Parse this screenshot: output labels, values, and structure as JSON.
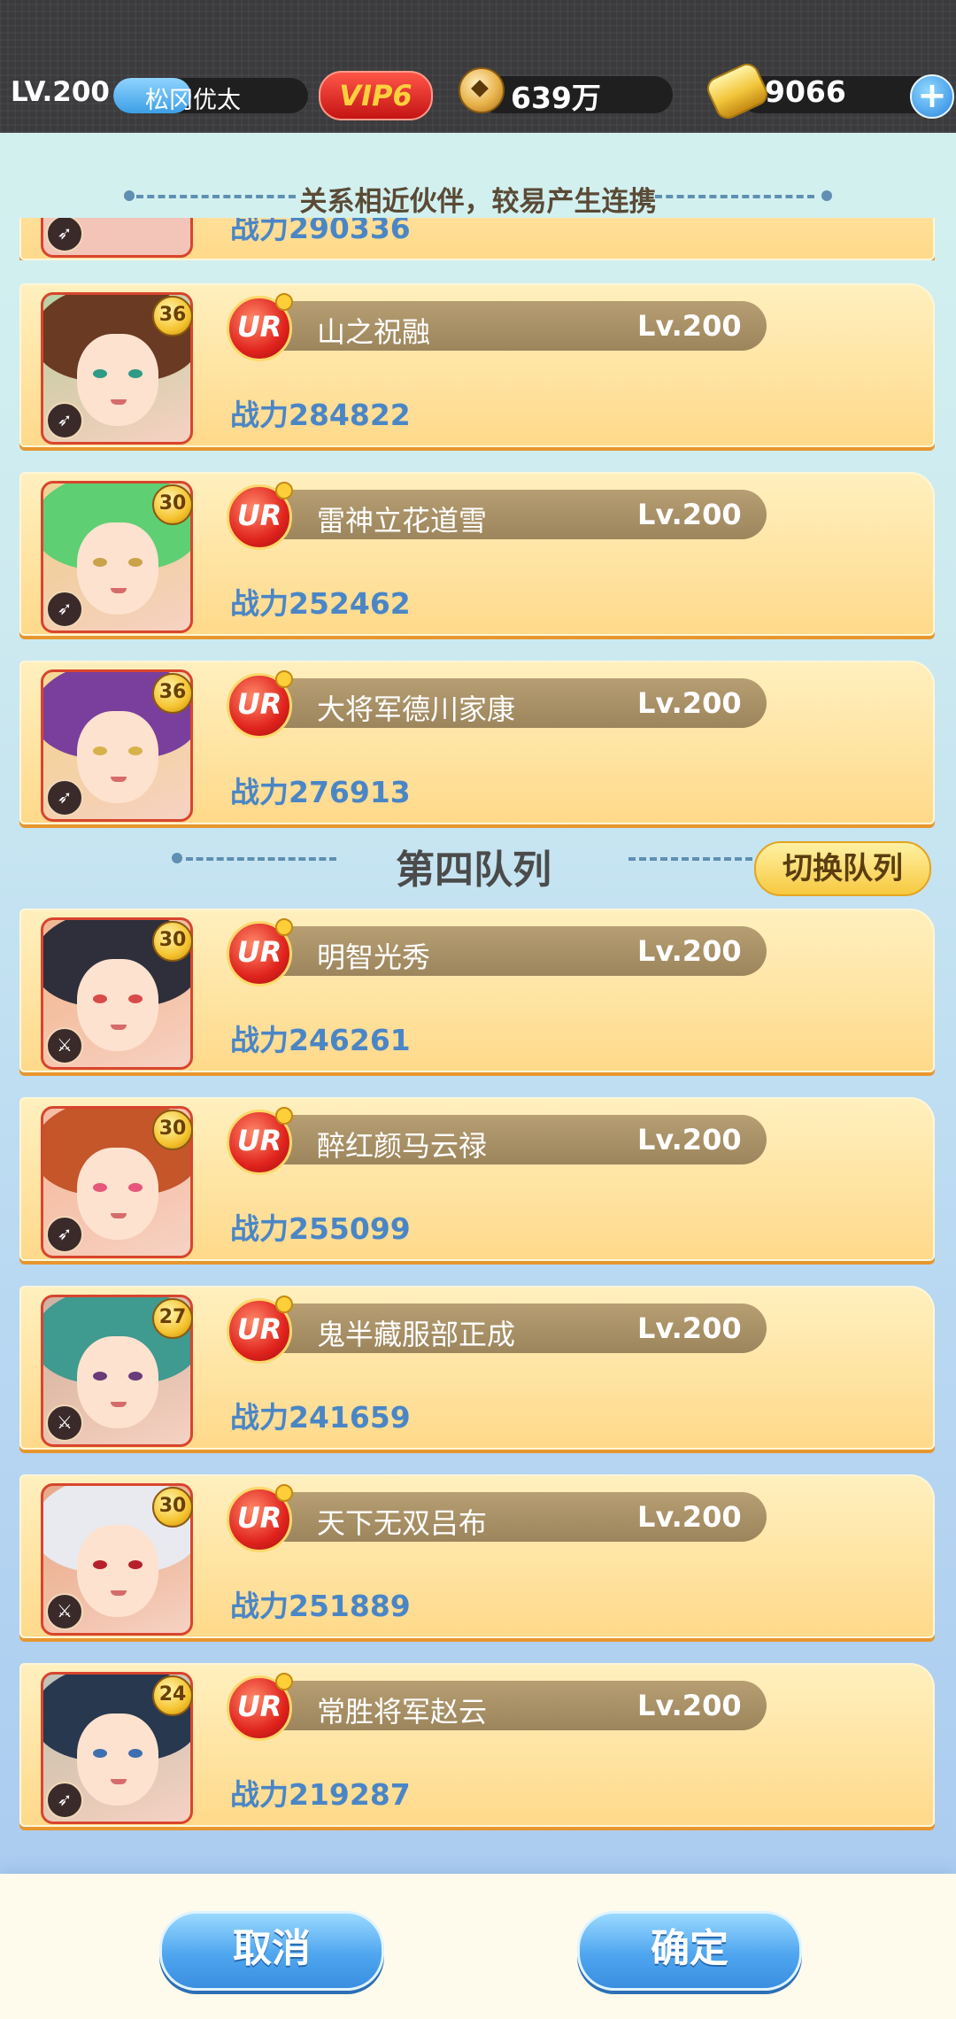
{
  "header": {
    "level": "LV.200",
    "player_name": "松冈优太",
    "exp_fraction": 0.4,
    "vip": "VIP6",
    "coins": "639万",
    "gold": "9066",
    "plus_icon": "plus-icon",
    "coin_icon": "coin-icon",
    "ingot_icon": "gold-ingot-icon"
  },
  "section_tip": "关系相近伙伴，较易产生连携",
  "partial_card": {
    "power": "战力290336"
  },
  "queue3": [
    {
      "name": "山之祝融",
      "level": "Lv.200",
      "power": "战力284822",
      "badge": "36",
      "rarity": "UR",
      "class_icon": "bow-icon",
      "hair": "#6b3a22",
      "accent": "#2f9a85"
    },
    {
      "name": "雷神立花道雪",
      "level": "Lv.200",
      "power": "战力252462",
      "badge": "30",
      "rarity": "UR",
      "class_icon": "bow-icon",
      "hair": "#5fcf73",
      "accent": "#c9a24a"
    },
    {
      "name": "大将军德川家康",
      "level": "Lv.200",
      "power": "战力276913",
      "badge": "36",
      "rarity": "UR",
      "class_icon": "bow-icon",
      "hair": "#7a3f9c",
      "accent": "#d7b24a"
    }
  ],
  "queue4": {
    "title": "第四队列",
    "switch_label": "切换队列",
    "cards": [
      {
        "name": "明智光秀",
        "level": "Lv.200",
        "power": "战力246261",
        "badge": "30",
        "rarity": "UR",
        "class_icon": "sword-icon",
        "hair": "#2e2f3b",
        "accent": "#d94a4a"
      },
      {
        "name": "醉红颜马云禄",
        "level": "Lv.200",
        "power": "战力255099",
        "badge": "30",
        "rarity": "UR",
        "class_icon": "bow-icon",
        "hair": "#c4562a",
        "accent": "#e7567a"
      },
      {
        "name": "鬼半藏服部正成",
        "level": "Lv.200",
        "power": "战力241659",
        "badge": "27",
        "rarity": "UR",
        "class_icon": "sword-icon",
        "hair": "#3f9a8f",
        "accent": "#6b3a7a"
      },
      {
        "name": "天下无双吕布",
        "level": "Lv.200",
        "power": "战力251889",
        "badge": "30",
        "rarity": "UR",
        "class_icon": "sword-icon",
        "hair": "#e8eaf0",
        "accent": "#b6202a"
      },
      {
        "name": "常胜将军赵云",
        "level": "Lv.200",
        "power": "战力219287",
        "badge": "24",
        "rarity": "UR",
        "class_icon": "bow-icon",
        "hair": "#27384f",
        "accent": "#3e6fb0"
      }
    ]
  },
  "buttons": {
    "cancel": "取消",
    "confirm": "确定"
  }
}
